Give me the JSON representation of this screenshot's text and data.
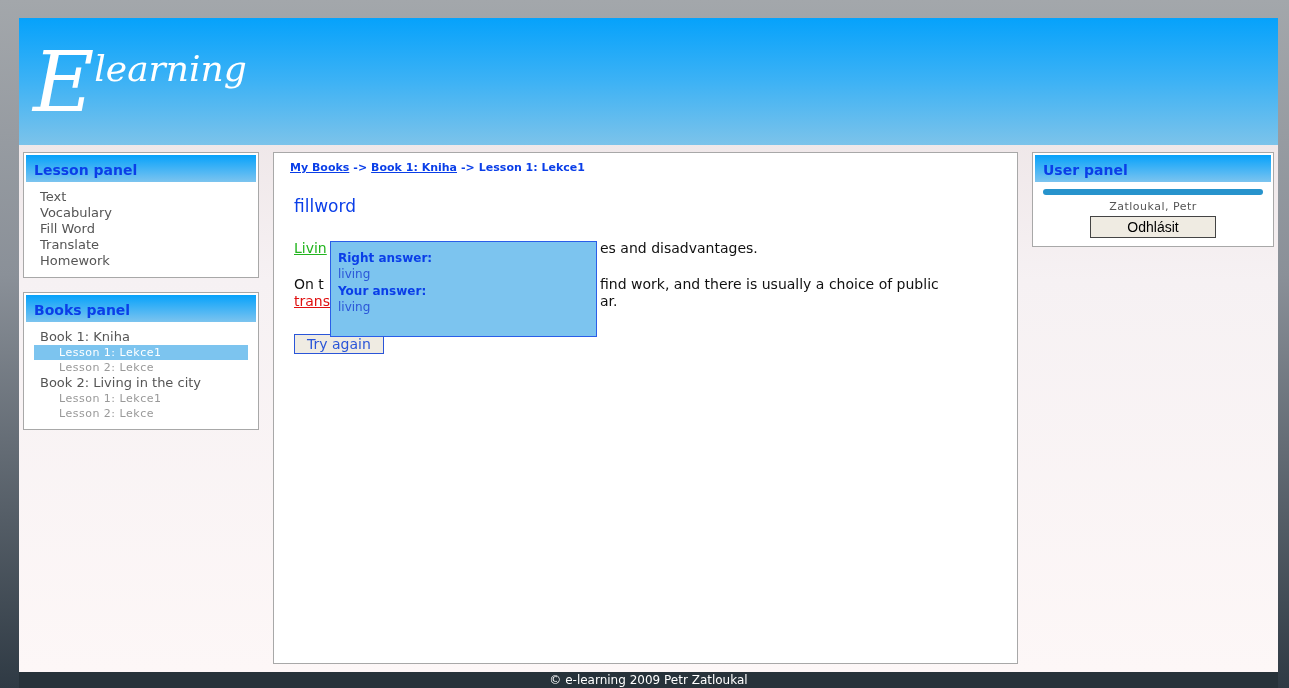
{
  "header": {
    "logo_initial": "E",
    "logo_text": "learning"
  },
  "lesson_panel": {
    "title": "Lesson panel",
    "items": [
      "Text",
      "Vocabulary",
      "Fill Word",
      "Translate",
      "Homework"
    ]
  },
  "books_panel": {
    "title": "Books panel",
    "books": [
      {
        "label": "Book 1: Kniha",
        "children": [
          {
            "label": "Lesson 1: Lekce1",
            "selected": true
          },
          {
            "label": "Lesson 2: Lekce",
            "selected": false
          }
        ]
      },
      {
        "label": "Book 2: Living in the city",
        "children": [
          {
            "label": "Lesson 1: Lekce1",
            "selected": false
          },
          {
            "label": "Lesson 2: Lekce",
            "selected": false
          }
        ]
      }
    ]
  },
  "breadcrumb": [
    {
      "label": "My Books",
      "kind": "link"
    },
    {
      "label": "->",
      "kind": "separator"
    },
    {
      "label": "Book 1: Kniha",
      "kind": "link"
    },
    {
      "label": "->",
      "kind": "separator"
    },
    {
      "label": "Lesson 1: Lekce1",
      "kind": "current"
    }
  ],
  "exercise": {
    "title": "fillword",
    "paragraphs": [
      [
        {
          "start": {
            "kind": "answer",
            "text": "Livin",
            "correct": true
          },
          "end": "es and disadvantages."
        }
      ],
      [
        {
          "start": {
            "kind": "text",
            "text": "On t"
          },
          "end": "find work, and there is usually a choice of public"
        },
        {
          "start": {
            "kind": "answer",
            "text": "trans",
            "correct": false
          },
          "end": "ar."
        }
      ]
    ],
    "button": "Try again",
    "tooltip": {
      "right_label": "Right answer:",
      "right_value": "living",
      "your_label": "Your answer:",
      "your_value": "living"
    }
  },
  "user_panel": {
    "title": "User panel",
    "name": "Zatloukal, Petr",
    "button": "Odhlásit"
  },
  "footer": "© e-learning 2009 Petr Zatloukal"
}
